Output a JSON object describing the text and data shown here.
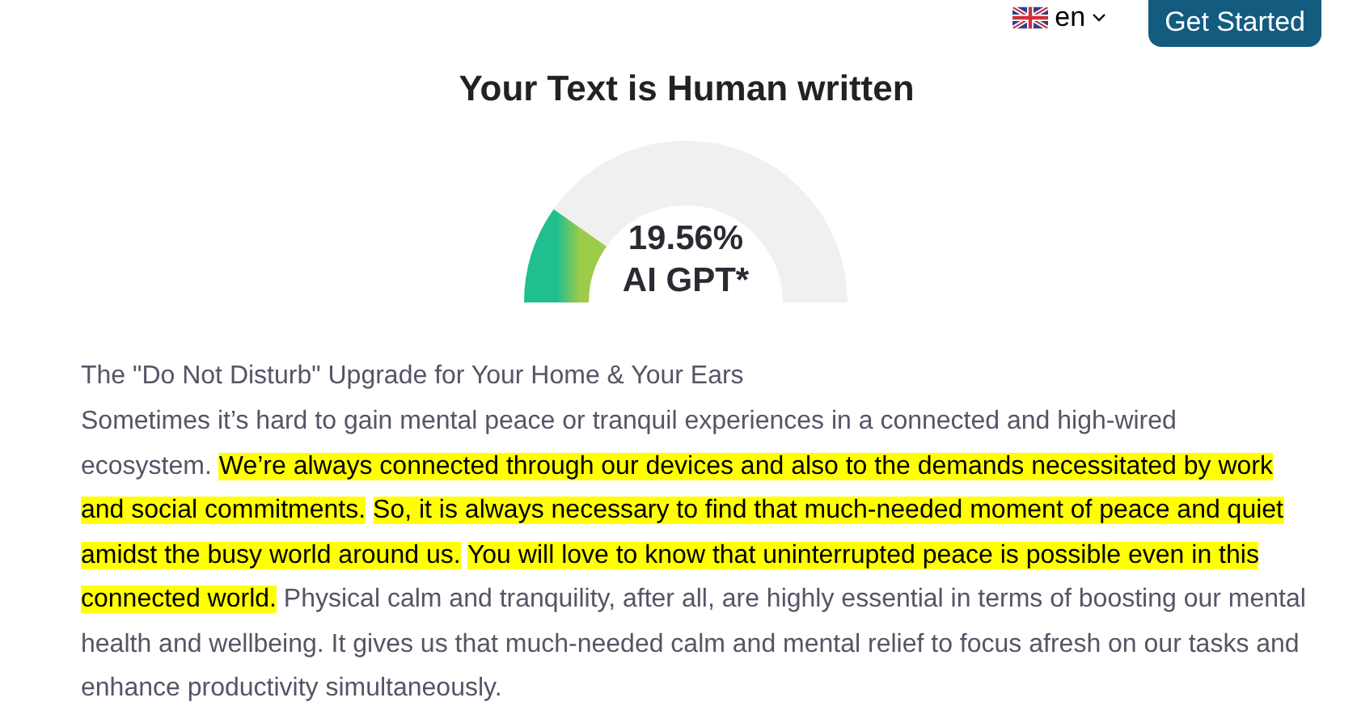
{
  "header": {
    "language": "en",
    "button": "Get Started"
  },
  "result": {
    "title": "Your Text is Human written",
    "score": "19.56%",
    "label": "AI GPT*"
  },
  "article": {
    "title": "The \"Do Not Disturb\" Upgrade for Your Home & Your Ears",
    "segments": [
      {
        "text": "Sometimes it’s hard to gain mental peace or tranquil experiences in a connected and high-wired ecosystem.",
        "highlighted": false
      },
      {
        "text": "We’re always connected through our devices and also to the demands necessitated by work and social commitments.",
        "highlighted": true
      },
      {
        "text": "So, it is always necessary to find that much-needed moment of peace and quiet amidst the busy world around us.",
        "highlighted": true
      },
      {
        "text": "You will love to know that uninterrupted peace is possible even in this connected world.",
        "highlighted": true
      },
      {
        "text": "Physical calm and tranquility, after all, are highly essential in terms of boosting our mental health and wellbeing. It gives us that much-needed calm and mental relief to focus afresh on our tasks and enhance productivity simultaneously.",
        "highlighted": false
      }
    ]
  }
}
